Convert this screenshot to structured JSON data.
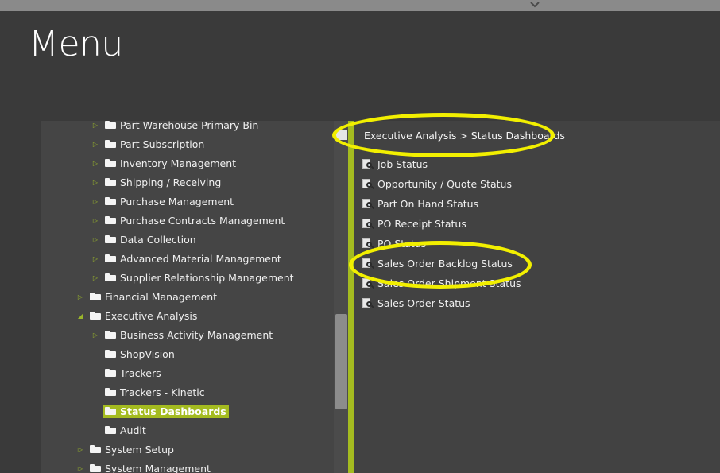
{
  "header": {
    "title": "Menu",
    "collapse_icon": "chevron-down-icon"
  },
  "tree": {
    "items": [
      {
        "label": "Part Warehouse Primary Bin",
        "level": 2,
        "expandable": true
      },
      {
        "label": "Part Subscription",
        "level": 2,
        "expandable": true
      },
      {
        "label": "Inventory Management",
        "level": 2,
        "expandable": true
      },
      {
        "label": "Shipping / Receiving",
        "level": 2,
        "expandable": true
      },
      {
        "label": "Purchase Management",
        "level": 2,
        "expandable": true
      },
      {
        "label": "Purchase Contracts Management",
        "level": 2,
        "expandable": true
      },
      {
        "label": "Data Collection",
        "level": 2,
        "expandable": true
      },
      {
        "label": "Advanced Material Management",
        "level": 2,
        "expandable": true
      },
      {
        "label": "Supplier Relationship Management",
        "level": 2,
        "expandable": true
      },
      {
        "label": "Financial Management",
        "level": 1,
        "expandable": true
      },
      {
        "label": "Executive Analysis",
        "level": 1,
        "expanded": true
      },
      {
        "label": "Business Activity Management",
        "level": 2,
        "expandable": true
      },
      {
        "label": "ShopVision",
        "level": 2
      },
      {
        "label": "Trackers",
        "level": 2
      },
      {
        "label": "Trackers - Kinetic",
        "level": 2
      },
      {
        "label": "Status Dashboards",
        "level": 2,
        "selected": true
      },
      {
        "label": "Audit",
        "level": 2
      },
      {
        "label": "System Setup",
        "level": 1,
        "expandable": true
      },
      {
        "label": "System Management",
        "level": 1,
        "expandable": true
      }
    ]
  },
  "breadcrumb": "Executive Analysis > Status Dashboards",
  "dashboards": {
    "icon": "dashboard-search-icon",
    "items": [
      "Job Status",
      "Opportunity / Quote Status",
      "Part On Hand Status",
      "PO Receipt Status",
      "PO Status",
      "Sales Order Backlog Status",
      "Sales Order Shipment Status",
      "Sales Order Status"
    ]
  },
  "colors": {
    "accent": "#a4bb20",
    "highlight": "#f2ef00",
    "background": "#3a3a3a"
  }
}
